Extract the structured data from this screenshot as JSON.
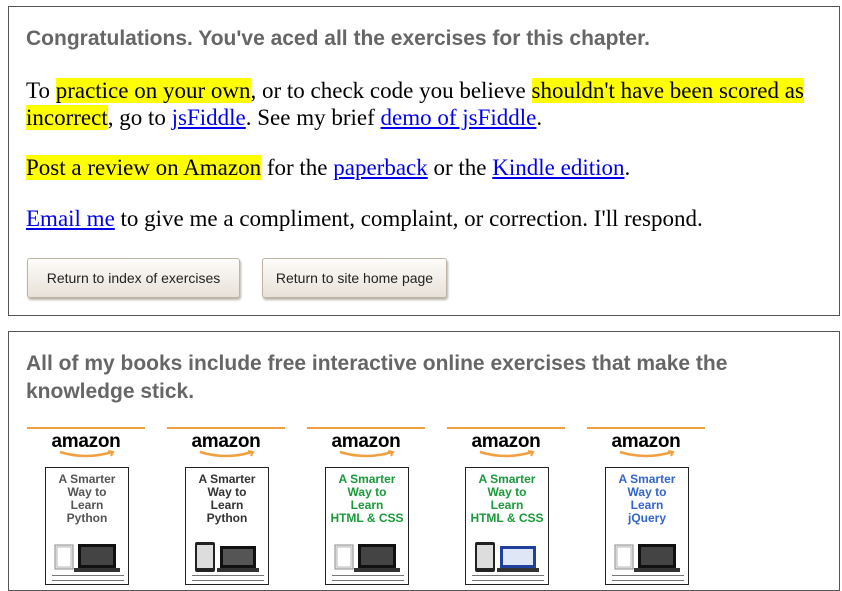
{
  "box1": {
    "heading": "Congratulations. You've aced all the exercises for this chapter.",
    "para1": {
      "t1": "To ",
      "h1": "practice on your own",
      "t2": ", or to check code you believe ",
      "h2": "shouldn't have been scored as incorrect",
      "t3": ", go to ",
      "link1": "jsFiddle",
      "t4": ". See my brief ",
      "link2": "demo of jsFiddle",
      "t5": "."
    },
    "para2": {
      "h1": "Post a review on Amazon",
      "t1": " for the ",
      "link1": "paperback",
      "t2": " or the ",
      "link2": "Kindle edition",
      "t3": "."
    },
    "para3": {
      "link1": "Email me",
      "t1": " to give me a compliment, complaint, or correction. I'll respond."
    },
    "buttons": {
      "index": "Return to index of exercises",
      "home": "Return to site home page"
    }
  },
  "box2": {
    "heading": "All of my books include free interactive online exercises that make the knowledge stick.",
    "books": [
      {
        "logo": "amazon",
        "title": "A Smarter Way to Learn Python",
        "title_lines": [
          "A Smarter",
          "Way to",
          "Learn",
          "Python"
        ],
        "color": "#555555",
        "icon": "book-laptop-icon"
      },
      {
        "logo": "amazon",
        "title": "A Smarter Way to Learn Python",
        "title_lines": [
          "A Smarter",
          "Way to",
          "Learn",
          "Python"
        ],
        "color": "#333333",
        "icon": "tablet-laptop-icon"
      },
      {
        "logo": "amazon",
        "title": "A Smarter Way to Learn HTML & CSS",
        "title_lines": [
          "A Smarter",
          "Way to",
          "Learn",
          "HTML & CSS"
        ],
        "color": "#1a9a3a",
        "icon": "book-laptop-icon"
      },
      {
        "logo": "amazon",
        "title": "A Smarter Way to Learn HTML & CSS",
        "title_lines": [
          "A Smarter",
          "Way to",
          "Learn",
          "HTML & CSS"
        ],
        "color": "#1a9a3a",
        "icon": "tablet-laptop-icon"
      },
      {
        "logo": "amazon",
        "title": "A Smarter Way to Learn jQuery",
        "title_lines": [
          "A Smarter",
          "Way to",
          "Learn",
          "jQuery"
        ],
        "color": "#3366cc",
        "icon": "book-laptop-icon"
      }
    ]
  },
  "colors": {
    "highlight": "#ffff00",
    "link": "#0000ee",
    "heading": "#666666",
    "amazon_smile": "#f0a040"
  }
}
